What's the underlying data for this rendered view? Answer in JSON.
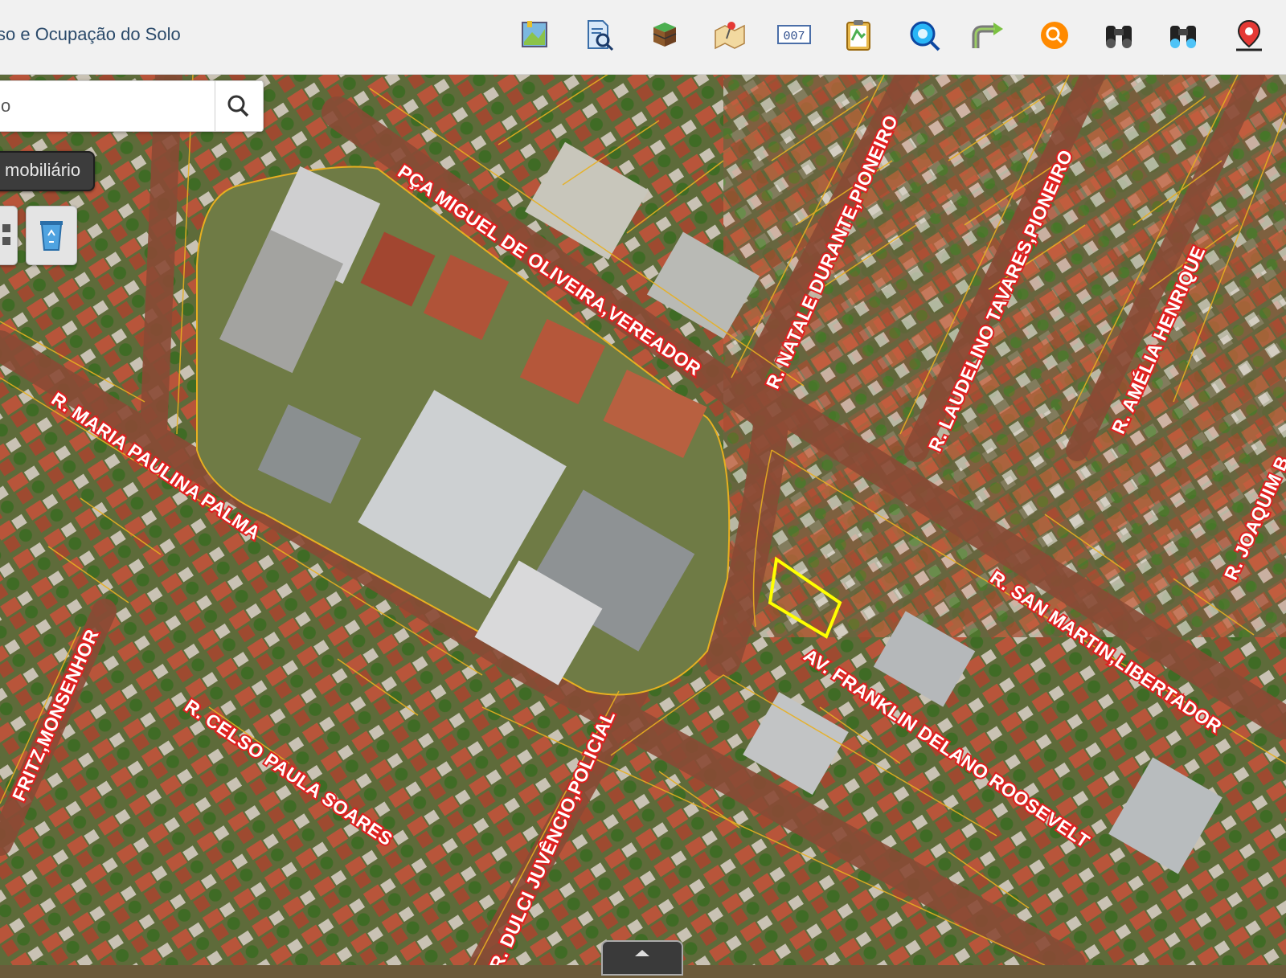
{
  "app": {
    "title": "so e Ocupação do Solo"
  },
  "toolbar": {
    "tools": [
      "map-view-icon",
      "document-search-icon",
      "layers-icon",
      "map-pin-icon",
      "counter-icon",
      "clipboard-icon",
      "globe-search-icon",
      "route-icon",
      "magnifier-icon",
      "binoculars-icon",
      "binoculars-alt-icon",
      "location-marker-icon"
    ],
    "counter_text": "007"
  },
  "search": {
    "value": "o"
  },
  "layer_button": {
    "label": "mobiliário"
  },
  "colors": {
    "street_label_fill": "#ffffff",
    "street_label_outline": "#e02020",
    "parcel_line": "#e8b020",
    "selected_parcel": "#ffff00"
  },
  "streets": [
    {
      "name": "PÇA MIGUEL DE OLIVEIRA,VEREADOR"
    },
    {
      "name": "R. NATALE DURANTE,PIONEIRO"
    },
    {
      "name": "R. LAUDELINO TAVARES,PIONEIRO"
    },
    {
      "name": "R. AMÉLIA HENRIQUE"
    },
    {
      "name": "R. JOAQUIM B"
    },
    {
      "name": "R. MARIA PAULINA PALMA"
    },
    {
      "name": "R. SAN MARTIN,LIBERTADOR"
    },
    {
      "name": "AV. FRANKLIN DELANO ROOSEVELT"
    },
    {
      "name": "FRITZ,MONSENHOR"
    },
    {
      "name": "R. CELSO PAULA SOARES"
    },
    {
      "name": "R. DULCI JUVÊNCIO,POLICIAL"
    }
  ]
}
